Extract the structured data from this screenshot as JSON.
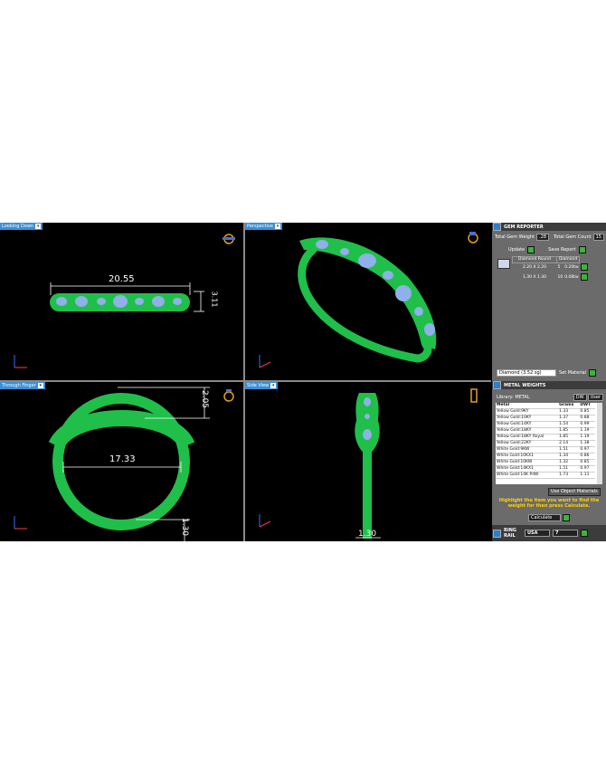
{
  "viewports": {
    "top_left": {
      "label": "Looking Down",
      "dimension": "20.55",
      "height_dim": "3.11"
    },
    "top_right": {
      "label": "Perspective"
    },
    "bottom_left": {
      "label": "Through Finger",
      "dimension": "17.33",
      "height_dim": "2.05",
      "band_dim": "1.30"
    },
    "bottom_right": {
      "label": "Side View",
      "dimension": "1.30"
    }
  },
  "gem_reporter": {
    "title": "GEM REPORTER",
    "total_weight_label": "Total Gem Weight",
    "total_weight_value": ".28",
    "total_count_label": "Total Gem Count",
    "total_count_value": "15",
    "update_label": "Update",
    "save_report_label": "Save Report",
    "table_headers": [
      "Diamond Round",
      "Diamond"
    ],
    "rows": [
      {
        "size": "2.20 X 2.20",
        "count": "5",
        "weight": "0.20tw"
      },
      {
        "size": "1.30 X 1.30",
        "count": "10",
        "weight": "0.08tw"
      }
    ],
    "material_select": "Diamond   (3.52 sg)",
    "set_material_label": "Set Material"
  },
  "metal_weights": {
    "title": "METAL WEIGHTS",
    "library_label": "Library: METAL",
    "dw_label": "DW",
    "user_label": "User",
    "headers": [
      "Metal",
      "Grams",
      "DWT"
    ],
    "rows": [
      {
        "metal": "Yellow Gold:9KY",
        "grams": "1.33",
        "dwt": "0.85"
      },
      {
        "metal": "Yellow Gold:10KY",
        "grams": "1.37",
        "dwt": "0.88"
      },
      {
        "metal": "Yellow Gold:14KY",
        "grams": "1.54",
        "dwt": "0.99"
      },
      {
        "metal": "Yellow Gold:18KY",
        "grams": "1.85",
        "dwt": "1.19"
      },
      {
        "metal": "Yellow Gold:18KY Royal",
        "grams": "1.85",
        "dwt": "1.19"
      },
      {
        "metal": "Yellow Gold:22KY",
        "grams": "2.14",
        "dwt": "1.38"
      },
      {
        "metal": "White Gold:9KW",
        "grams": "1.51",
        "dwt": "0.97"
      },
      {
        "metal": "White Gold:10KX1",
        "grams": "1.34",
        "dwt": "0.86"
      },
      {
        "metal": "White Gold:10KW",
        "grams": "1.32",
        "dwt": "0.85"
      },
      {
        "metal": "White Gold:14KX1",
        "grams": "1.51",
        "dwt": "0.97"
      },
      {
        "metal": "White Gold:14K PdW",
        "grams": "1.73",
        "dwt": "1.11"
      }
    ],
    "use_object_materials": "Use Object Materials",
    "note": "Highlight the item you want to find the weight for then press Calculate.",
    "calculate_label": "Calculate"
  },
  "ring_rail": {
    "title": "RING RAIL",
    "region": "USA",
    "size": "7"
  },
  "colors": {
    "band": "#1fbf4a",
    "gem": "#8fb0e8",
    "dim_line": "#ffffff",
    "tab": "#3a8fd4"
  }
}
